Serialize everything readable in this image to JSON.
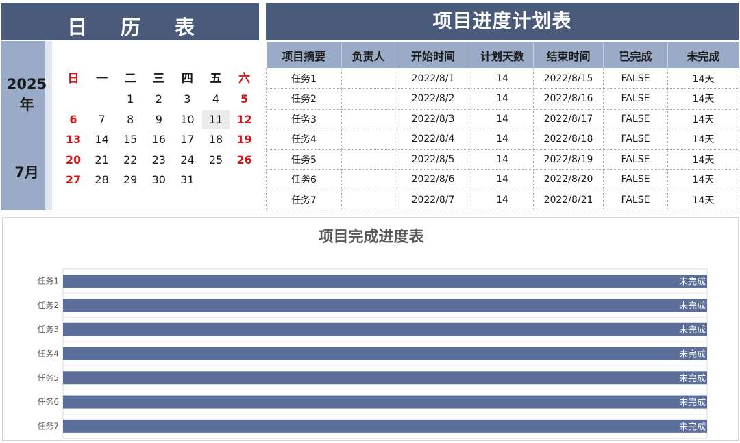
{
  "calendar": {
    "header_chars": [
      "日",
      "历",
      "表"
    ],
    "year_line1": "2025",
    "year_line2": "年",
    "month": "7月",
    "weekdays": [
      "日",
      "一",
      "二",
      "三",
      "四",
      "五",
      "六"
    ],
    "weeks": [
      [
        "",
        "",
        "1",
        "2",
        "3",
        "4",
        "5"
      ],
      [
        "6",
        "7",
        "8",
        "9",
        "10",
        "11",
        "12"
      ],
      [
        "13",
        "14",
        "15",
        "16",
        "17",
        "18",
        "19"
      ],
      [
        "20",
        "21",
        "22",
        "23",
        "24",
        "25",
        "26"
      ],
      [
        "27",
        "28",
        "29",
        "30",
        "31",
        "",
        ""
      ]
    ],
    "highlighted_day": "11"
  },
  "progress_table": {
    "title": "项目进度计划表",
    "headers": [
      "项目摘要",
      "负责人",
      "开始时间",
      "计划天数",
      "结束时间",
      "已完成",
      "未完成"
    ],
    "rows": [
      [
        "任务1",
        "",
        "2022/8/1",
        "14",
        "2022/8/15",
        "FALSE",
        "14天"
      ],
      [
        "任务2",
        "",
        "2022/8/2",
        "14",
        "2022/8/16",
        "FALSE",
        "14天"
      ],
      [
        "任务3",
        "",
        "2022/8/3",
        "14",
        "2022/8/17",
        "FALSE",
        "14天"
      ],
      [
        "任务4",
        "",
        "2022/8/4",
        "14",
        "2022/8/18",
        "FALSE",
        "14天"
      ],
      [
        "任务5",
        "",
        "2022/8/5",
        "14",
        "2022/8/19",
        "FALSE",
        "14天"
      ],
      [
        "任务6",
        "",
        "2022/8/6",
        "14",
        "2022/8/20",
        "FALSE",
        "14天"
      ],
      [
        "任务7",
        "",
        "2022/8/7",
        "14",
        "2022/8/21",
        "FALSE",
        "14天"
      ]
    ]
  },
  "chart_data": {
    "type": "bar",
    "orientation": "horizontal",
    "title": "项目完成进度表",
    "categories": [
      "任务1",
      "任务2",
      "任务3",
      "任务4",
      "任务5",
      "任务6",
      "任务7"
    ],
    "series": [
      {
        "values": [
          14,
          14,
          14,
          14,
          14,
          14,
          14
        ],
        "data_label": "未完成"
      }
    ],
    "xlim": [
      0,
      14
    ],
    "grid": true,
    "bar_color": "#5b6e99"
  },
  "colors": {
    "header_bg": "#4a5a7a",
    "subheader_bg": "#9aabc7",
    "weekend_red": "#d01818"
  }
}
